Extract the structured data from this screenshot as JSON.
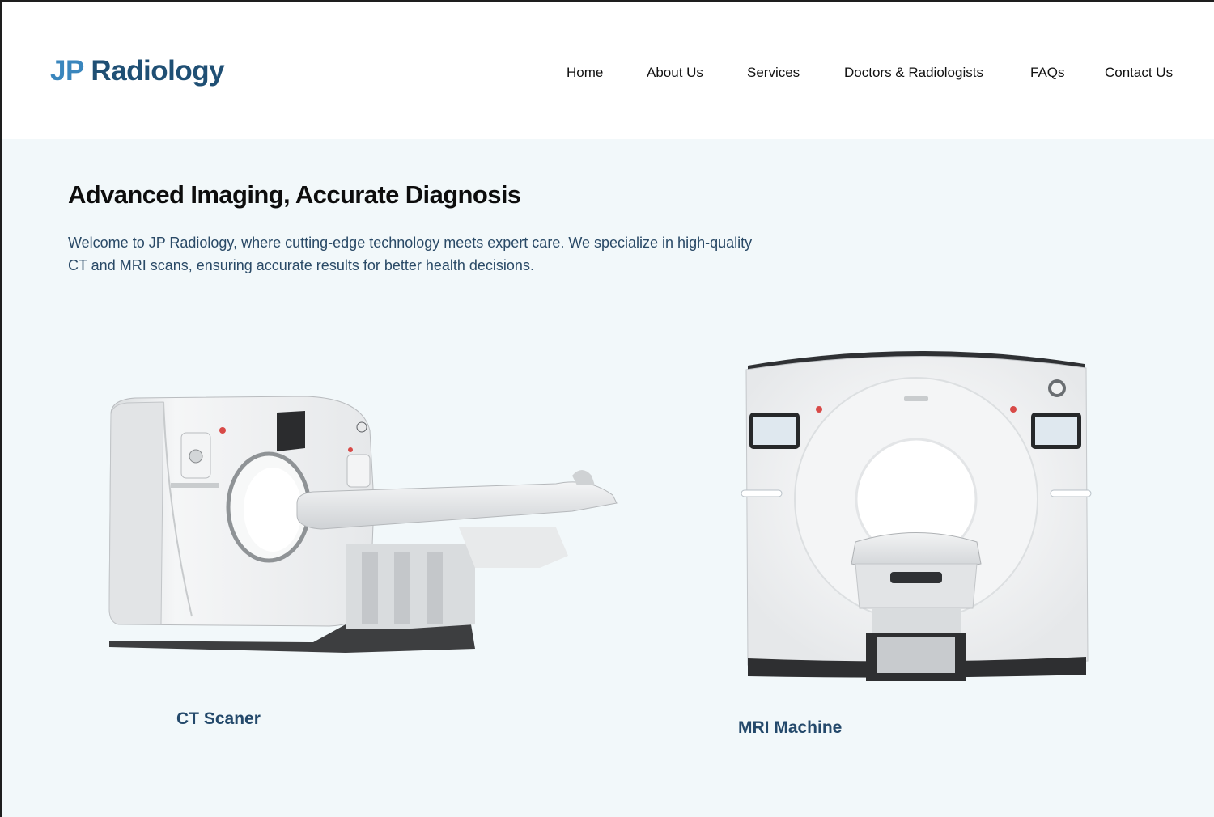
{
  "brand": {
    "part1": "JP",
    "part2": "Radiology",
    "color_primary": "#3a86bd",
    "color_secondary": "#1f4f74"
  },
  "nav": {
    "items": [
      {
        "label": "Home"
      },
      {
        "label": "About Us"
      },
      {
        "label": "Services"
      },
      {
        "label": "Doctors & Radiologists"
      },
      {
        "label": "FAQs"
      },
      {
        "label": "Contact Us"
      }
    ]
  },
  "hero": {
    "title": "Advanced Imaging, Accurate Diagnosis",
    "description": "Welcome to JP Radiology, where cutting-edge technology meets expert care. We specialize in high-quality CT and MRI scans, ensuring accurate results for better health decisions.",
    "background": "#f2f8fa"
  },
  "machines": [
    {
      "label": "CT Scaner",
      "icon": "ct-scanner-image"
    },
    {
      "label": "MRI Machine",
      "icon": "mri-machine-image"
    }
  ]
}
